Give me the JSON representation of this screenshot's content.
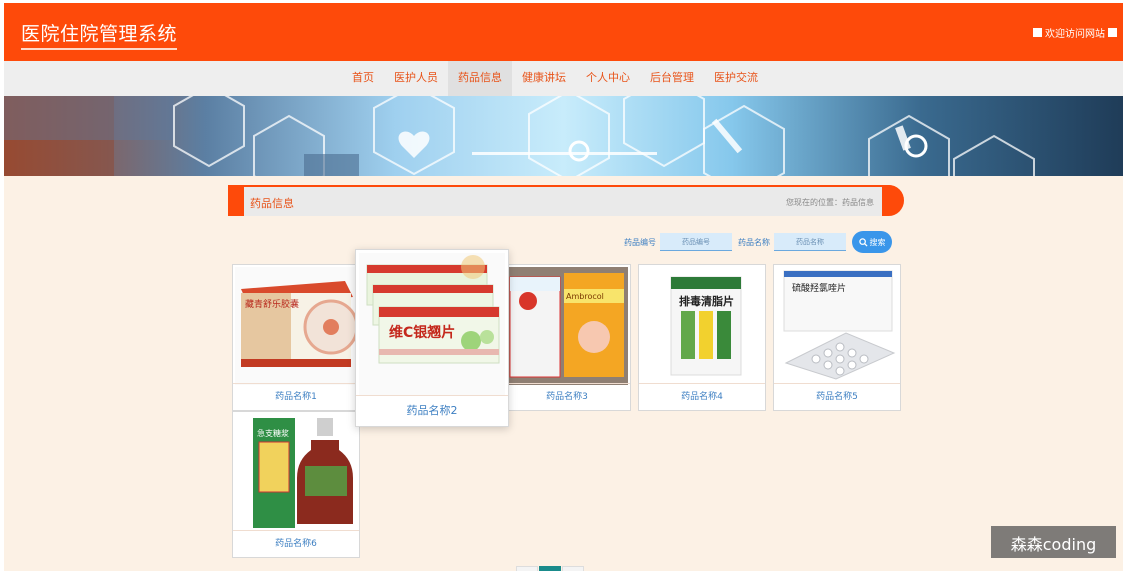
{
  "header": {
    "title": "医院住院管理系统",
    "welcome": "欢迎访问网站"
  },
  "nav": {
    "items": [
      "首页",
      "医护人员",
      "药品信息",
      "健康讲坛",
      "个人中心",
      "后台管理",
      "医护交流"
    ],
    "active_index": 2
  },
  "breadcrumb": {
    "title": "药品信息",
    "location": "您现在的位置：药品信息"
  },
  "search": {
    "code_label": "药品编号",
    "code_placeholder": "药品编号",
    "name_label": "药品名称",
    "name_placeholder": "药品名称",
    "button_label": "搜索"
  },
  "products": [
    {
      "name": "药品名称1",
      "icon": "medicine-box-icon",
      "box_text": "藏青舒乐胶囊"
    },
    {
      "name": "药品名称2",
      "icon": "medicine-box-icon",
      "box_text": "维C银翘片"
    },
    {
      "name": "药品名称3",
      "icon": "medicine-box-icon",
      "box_text": "Ambrocol"
    },
    {
      "name": "药品名称4",
      "icon": "medicine-box-icon",
      "box_text": "排毒清脂片"
    },
    {
      "name": "药品名称5",
      "icon": "medicine-box-icon",
      "box_text": "硫酸羟氯喹片"
    },
    {
      "name": "药品名称6",
      "icon": "medicine-bottle-icon",
      "box_text": "急支糖浆"
    }
  ],
  "watermark": "森森coding",
  "colors": {
    "brand": "#fe4a0a",
    "nav_text": "#e8541a",
    "link_blue": "#3d7fc2",
    "search_button": "#3a96ea",
    "page_bg": "#fcf1e5"
  }
}
